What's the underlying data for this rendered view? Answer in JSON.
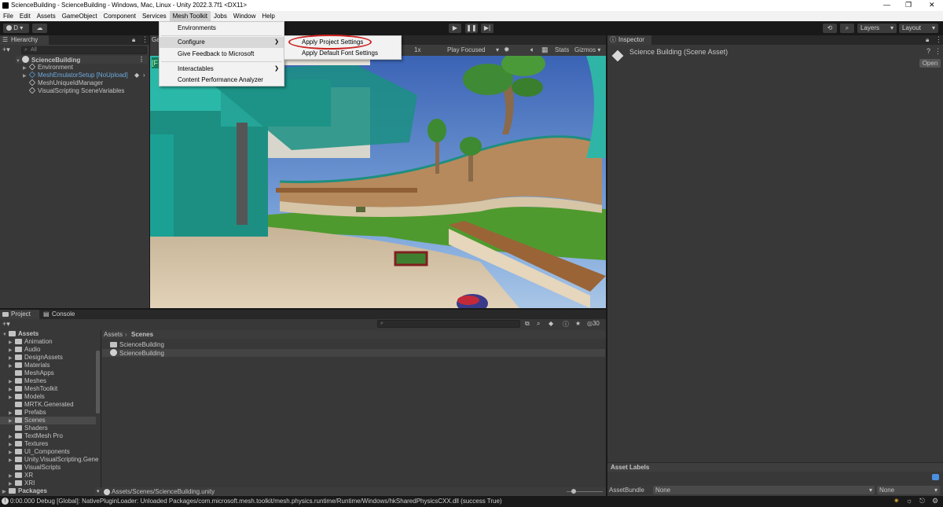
{
  "window": {
    "title": "ScienceBuilding - ScienceBuilding - Windows, Mac, Linux - Unity 2022.3.7f1 <DX11>",
    "controls": [
      "—",
      "❐",
      "✕"
    ]
  },
  "menubar": [
    "File",
    "Edit",
    "Assets",
    "GameObject",
    "Component",
    "Services",
    "Mesh Toolkit",
    "Jobs",
    "Window",
    "Help"
  ],
  "toolbar": {
    "account": "D",
    "layers": "Layers",
    "layout": "Layout"
  },
  "hierarchy": {
    "tab": "Hierarchy",
    "search_placeholder": "All",
    "scene": "ScienceBuilding",
    "items": [
      "Environment",
      "MeshEmulatorSetup [NoUpload]",
      "MeshUniqueIdManager",
      "VisualScripting SceneVariables"
    ]
  },
  "mesh_toolkit_menu": {
    "items": [
      "Environments",
      "Configure",
      "Give Feedback to Microsoft",
      "Interactables",
      "Content Performance Analyzer"
    ]
  },
  "configure_submenu": {
    "items": [
      "Apply Project Settings",
      "Apply Default Font Settings"
    ],
    "highlight_color": "#cc2222"
  },
  "game_view": {
    "tab_partial": "Ga",
    "scale": "1x",
    "play_mode": "Play Focused",
    "stats": "Stats",
    "gizmos": "Gizmos",
    "corner_text": "[F"
  },
  "inspector": {
    "tab": "Inspector",
    "title": "Science Building (Scene Asset)",
    "open_button": "Open",
    "asset_labels": "Asset Labels",
    "asset_bundle_label": "AssetBundle",
    "asset_bundle_value": "None",
    "variant_value": "None"
  },
  "project": {
    "tab": "Project",
    "console_tab": "Console",
    "root": "Assets",
    "folders": [
      "Animation",
      "Audio",
      "DesignAssets",
      "Materials",
      "MeshApps",
      "Meshes",
      "MeshToolkit",
      "Models",
      "MRTK.Generated",
      "Prefabs",
      "Scenes",
      "Shaders",
      "TextMesh Pro",
      "Textures",
      "UI_Components",
      "Unity.VisualScripting.Gene",
      "VisualScripts",
      "XR",
      "XRI"
    ],
    "packages": "Packages",
    "breadcrumb": [
      "Assets",
      "Scenes"
    ],
    "files": [
      "ScienceBuilding",
      "ScienceBuilding"
    ],
    "path": "Assets/Scenes/ScienceBuilding.unity",
    "hidden_count": "30"
  },
  "status_bar": {
    "message": "0:00.000 Debug [Global]: NativePluginLoader: Unloaded Packages/com.microsoft.mesh.toolkit/mesh.physics.runtime/Runtime/Windows/hkSharedPhysicsCXX.dll (success True)"
  }
}
